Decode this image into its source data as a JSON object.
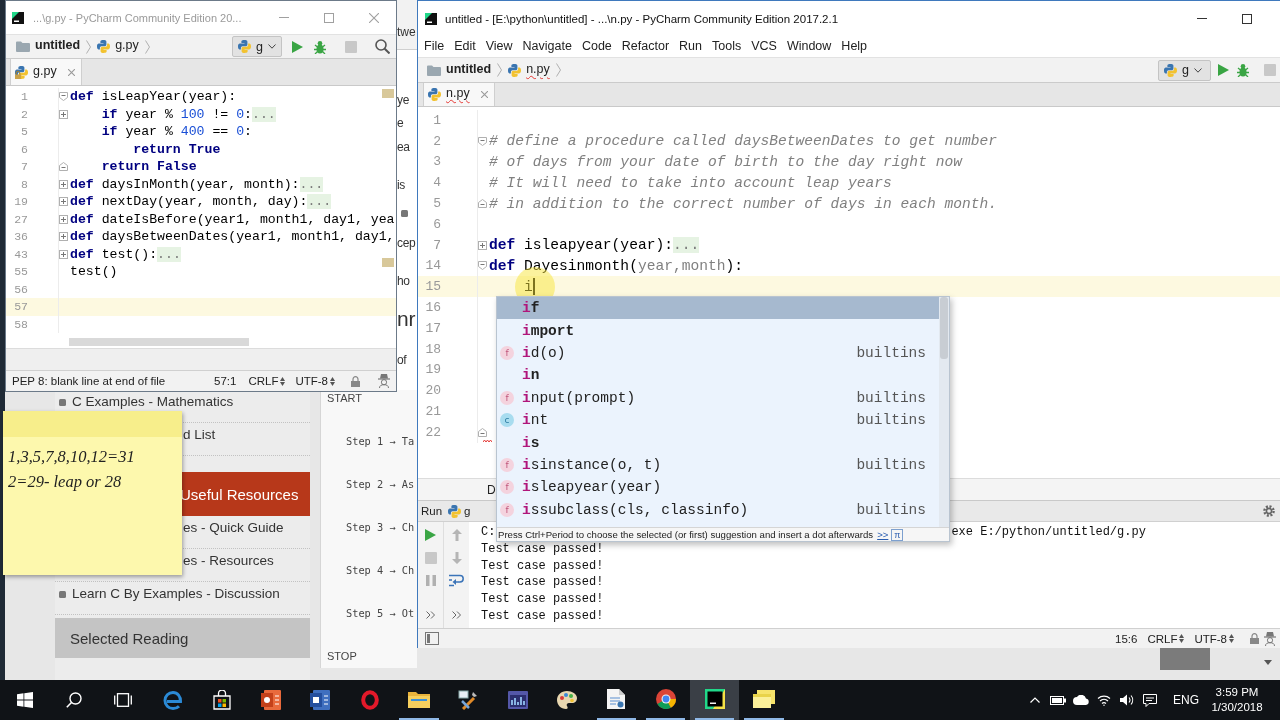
{
  "browser": {
    "strip": {
      "nav": "twe",
      "lines": [
        {
          "kind": "text",
          "text": "ye"
        },
        {
          "kind": "text",
          "text": "e"
        },
        {
          "kind": "text",
          "text": "ea"
        },
        {
          "kind": "text",
          "text": "is"
        },
        {
          "kind": "bullet"
        },
        {
          "kind": "text",
          "text": "cep"
        },
        {
          "kind": "text",
          "text": "ho"
        },
        {
          "kind": "heading",
          "text": "nr"
        },
        {
          "kind": "text",
          "text": "of"
        }
      ]
    },
    "sidebar": [
      {
        "kind": "link",
        "text": "C Examples - Mathematics",
        "covered": false
      },
      {
        "kind": "link",
        "text": "d List",
        "covered": true
      },
      {
        "kind": "header",
        "text": "Useful Resources",
        "covered": true,
        "color": "#b7381a"
      },
      {
        "kind": "link",
        "text": "es - Quick Guide",
        "covered": true
      },
      {
        "kind": "link",
        "text": "es - Resources",
        "covered": true
      },
      {
        "kind": "link",
        "text": "Learn C By Examples - Discussion",
        "covered": false
      },
      {
        "kind": "header",
        "text": "Selected Reading",
        "covered": false,
        "color": "#c4c4c4"
      }
    ],
    "flowchart": {
      "start": "START",
      "steps": [
        "Step 1 → Ta",
        "Step 2 → As",
        "Step 3 → Ch",
        "Step 4 → Ch",
        "Step 5 → Ot"
      ],
      "stop": "STOP"
    }
  },
  "left_window": {
    "title": "...\\g.py - PyCharm Community Edition 20...",
    "active": false,
    "controls": [
      {
        "kind": "minimize"
      },
      {
        "kind": "maximize"
      },
      {
        "kind": "close"
      }
    ],
    "breadcrumbs": [
      {
        "kind": "folder",
        "label": "untitled",
        "error": false
      },
      {
        "kind": "file",
        "label": "g.py",
        "error": false
      }
    ],
    "run_config": "g",
    "toolbar": [
      {
        "kind": "run",
        "disabled": false
      },
      {
        "kind": "debug",
        "disabled": false
      },
      {
        "kind": "stop",
        "disabled": true
      },
      {
        "kind": "search",
        "disabled": false
      }
    ],
    "tabs": [
      {
        "label": "g.py",
        "selected": true,
        "error": false,
        "read_only": true
      }
    ],
    "editor": {
      "lines": [
        {
          "number": "1",
          "marker": {
            "kind": "fold_open"
          },
          "current": false,
          "tokens": [
            {
              "kind": "keyword",
              "text": "def"
            },
            {
              "kind": "plain",
              "text": " isLeapYear(year):"
            }
          ]
        },
        {
          "number": "2",
          "marker": {
            "kind": "fold_collapsed"
          },
          "current": false,
          "tokens": [
            {
              "kind": "keyword",
              "text": "    if"
            },
            {
              "kind": "plain",
              "text": " year % "
            },
            {
              "kind": "number",
              "text": "100"
            },
            {
              "kind": "plain",
              "text": " != "
            },
            {
              "kind": "number",
              "text": "0"
            },
            {
              "kind": "plain",
              "text": ":"
            },
            {
              "kind": "folded",
              "text": "..."
            }
          ]
        },
        {
          "number": "5",
          "current": false,
          "tokens": [
            {
              "kind": "keyword",
              "text": "    if"
            },
            {
              "kind": "plain",
              "text": " year % "
            },
            {
              "kind": "number",
              "text": "400"
            },
            {
              "kind": "plain",
              "text": " == "
            },
            {
              "kind": "number",
              "text": "0"
            },
            {
              "kind": "plain",
              "text": ":"
            }
          ]
        },
        {
          "number": "6",
          "current": false,
          "tokens": [
            {
              "kind": "keyword",
              "text": "        return True"
            }
          ]
        },
        {
          "number": "7",
          "marker": {
            "kind": "fold_close"
          },
          "current": false,
          "tokens": [
            {
              "kind": "keyword",
              "text": "    return False"
            }
          ]
        },
        {
          "number": "8",
          "marker": {
            "kind": "fold_collapsed"
          },
          "current": false,
          "tokens": [
            {
              "kind": "keyword",
              "text": "def"
            },
            {
              "kind": "plain",
              "text": " daysInMonth(year, month):"
            },
            {
              "kind": "folded",
              "text": "..."
            }
          ]
        },
        {
          "number": "19",
          "marker": {
            "kind": "fold_collapsed"
          },
          "current": false,
          "tokens": [
            {
              "kind": "keyword",
              "text": "def"
            },
            {
              "kind": "plain",
              "text": " nextDay(year, month, day):"
            },
            {
              "kind": "folded",
              "text": "..."
            }
          ]
        },
        {
          "number": "27",
          "marker": {
            "kind": "fold_collapsed"
          },
          "current": false,
          "tokens": [
            {
              "kind": "keyword",
              "text": "def"
            },
            {
              "kind": "plain",
              "text": " dateIsBefore(year1, month1, day1, yea"
            }
          ]
        },
        {
          "number": "36",
          "marker": {
            "kind": "fold_collapsed"
          },
          "current": false,
          "tokens": [
            {
              "kind": "keyword",
              "text": "def"
            },
            {
              "kind": "plain",
              "text": " daysBetweenDates(year1, month1, day1,"
            }
          ]
        },
        {
          "number": "43",
          "marker": {
            "kind": "fold_collapsed"
          },
          "current": false,
          "tokens": [
            {
              "kind": "keyword",
              "text": "def"
            },
            {
              "kind": "plain",
              "text": " test():"
            },
            {
              "kind": "folded",
              "text": "..."
            }
          ]
        },
        {
          "number": "55",
          "current": false,
          "tokens": [
            {
              "kind": "plain",
              "text": "test()"
            }
          ]
        },
        {
          "number": "56",
          "current": false
        },
        {
          "number": "57",
          "current": true
        },
        {
          "number": "58",
          "current": false
        }
      ]
    },
    "status": {
      "message": "PEP 8: blank line at end of file",
      "position": "57:1",
      "line_separator": "CRLF",
      "encoding": "UTF-8"
    }
  },
  "sticky_note": {
    "lines": [
      "1,3,5,7,8,10,12=31",
      "2=29- leap or 28"
    ]
  },
  "right_window": {
    "title": "untitled - [E:\\python\\untitled] - ...\\n.py - PyCharm Community Edition 2017.2.1",
    "active": true,
    "controls": [
      {
        "kind": "minimize"
      },
      {
        "kind": "maximize"
      }
    ],
    "menu": [
      "File",
      "Edit",
      "View",
      "Navigate",
      "Code",
      "Refactor",
      "Run",
      "Tools",
      "VCS",
      "Window",
      "Help"
    ],
    "breadcrumbs": [
      {
        "kind": "folder",
        "label": "untitled",
        "error": false
      },
      {
        "kind": "file",
        "label": "n.py",
        "error": true
      }
    ],
    "run_config": "g",
    "toolbar": [
      {
        "kind": "run",
        "disabled": false
      },
      {
        "kind": "debug",
        "disabled": false
      },
      {
        "kind": "stop",
        "disabled": true
      }
    ],
    "tabs": [
      {
        "label": "n.py",
        "selected": true,
        "error": true,
        "read_only": false
      }
    ],
    "editor": {
      "lines": [
        {
          "number": "1",
          "current": false,
          "caret": false
        },
        {
          "number": "2",
          "marker": {
            "kind": "fold_open"
          },
          "current": false,
          "caret": false,
          "tokens": [
            {
              "kind": "comment",
              "text": "# define a procedure called daysBetweenDates to get number"
            }
          ]
        },
        {
          "number": "3",
          "current": false,
          "caret": false,
          "tokens": [
            {
              "kind": "comment",
              "text": "# of days from your date of birth to the day right now"
            }
          ]
        },
        {
          "number": "4",
          "current": false,
          "caret": false,
          "tokens": [
            {
              "kind": "comment",
              "text": "# It will need to take into account leap years"
            }
          ]
        },
        {
          "number": "5",
          "marker": {
            "kind": "fold_close"
          },
          "current": false,
          "caret": false,
          "tokens": [
            {
              "kind": "comment",
              "text": "# in addition to the correct number of days in each month."
            }
          ]
        },
        {
          "number": "6",
          "current": false,
          "caret": false
        },
        {
          "number": "7",
          "marker": {
            "kind": "fold_collapsed"
          },
          "current": false,
          "caret": false,
          "tokens": [
            {
              "kind": "keyword",
              "text": "def"
            },
            {
              "kind": "plain",
              "text": " isleapyear(year):"
            },
            {
              "kind": "folded",
              "text": "..."
            }
          ]
        },
        {
          "number": "14",
          "marker": {
            "kind": "fold_open"
          },
          "current": false,
          "caret": false,
          "tokens": [
            {
              "kind": "keyword",
              "text": "def"
            },
            {
              "kind": "plain",
              "text": " Dayesinmonth("
            },
            {
              "kind": "unused",
              "text": "year,month"
            },
            {
              "kind": "plain",
              "text": "):"
            }
          ]
        },
        {
          "number": "15",
          "current": true,
          "caret": true,
          "tokens": [
            {
              "kind": "plain",
              "text": "    i"
            }
          ]
        },
        {
          "number": "16",
          "current": false,
          "caret": false
        },
        {
          "number": "17",
          "current": false,
          "caret": false
        },
        {
          "number": "18",
          "current": false,
          "caret": false
        },
        {
          "number": "19",
          "current": false,
          "caret": false
        },
        {
          "number": "20",
          "current": false,
          "caret": false
        },
        {
          "number": "21",
          "current": false,
          "caret": false
        },
        {
          "number": "22",
          "marker": {
            "kind": "fold_close"
          },
          "current": false,
          "caret": false
        }
      ]
    },
    "completion": {
      "items": [
        {
          "kind": "keyword",
          "text": "if",
          "selected": true
        },
        {
          "kind": "keyword",
          "text": "import",
          "selected": false
        },
        {
          "kind": "function",
          "badge": "f",
          "text": "id(o)",
          "source": "builtins",
          "selected": false
        },
        {
          "kind": "keyword",
          "text": "in",
          "selected": false
        },
        {
          "kind": "function",
          "badge": "f",
          "text": "input(prompt)",
          "source": "builtins",
          "selected": false
        },
        {
          "kind": "class",
          "badge": "c",
          "text": "int",
          "source": "builtins",
          "selected": false
        },
        {
          "kind": "keyword",
          "text": "is",
          "selected": false
        },
        {
          "kind": "function",
          "badge": "f",
          "text": "isinstance(o, t)",
          "source": "builtins",
          "selected": false
        },
        {
          "kind": "function",
          "badge": "f",
          "text": "isleapyear(year)",
          "selected": false
        },
        {
          "kind": "function",
          "badge": "f",
          "text": "issubclass(cls, classinfo)",
          "source": "builtins",
          "selected": false
        }
      ],
      "hint": "Press Ctrl+Period to choose the selected (or first) suggestion and insert a dot afterwards",
      "hint_link": ">>",
      "pi": "π"
    },
    "structure_path": "D",
    "run_panel": {
      "title": "Run",
      "config": "g",
      "console": [
        {
          "segments": [
            "C:",
            "exe E:/python/untitled/g.py"
          ]
        },
        {
          "segments": [
            "Test case passed!"
          ]
        },
        {
          "segments": [
            "Test case passed!"
          ]
        },
        {
          "segments": [
            "Test case passed!"
          ]
        },
        {
          "segments": [
            "Test case passed!"
          ]
        },
        {
          "segments": [
            "Test case passed!"
          ]
        }
      ]
    },
    "status": {
      "position": "15:6",
      "line_separator": "CRLF",
      "encoding": "UTF-8"
    }
  },
  "taskbar": {
    "buttons": [
      {
        "kind": "start"
      },
      {
        "kind": "search"
      },
      {
        "kind": "task_view"
      }
    ],
    "apps": [
      {
        "kind": "e_browser",
        "running": false,
        "selected": false
      },
      {
        "kind": "store",
        "running": false,
        "selected": false
      },
      {
        "kind": "slides",
        "running": false,
        "selected": false
      },
      {
        "kind": "doc",
        "running": false,
        "selected": false
      },
      {
        "kind": "ring_browser",
        "running": false,
        "selected": false
      },
      {
        "kind": "folder",
        "running": true,
        "selected": false
      },
      {
        "kind": "tools",
        "running": false,
        "selected": false
      },
      {
        "kind": "dashboard",
        "running": false,
        "selected": false
      },
      {
        "kind": "palette",
        "running": false,
        "selected": false
      },
      {
        "kind": "notepad",
        "running": true,
        "selected": false
      },
      {
        "kind": "round_browser",
        "running": true,
        "selected": false
      },
      {
        "kind": "ide",
        "running": true,
        "selected": true
      },
      {
        "kind": "notes",
        "running": true,
        "selected": false
      }
    ],
    "tray": [
      {
        "kind": "chevron"
      },
      {
        "kind": "battery"
      },
      {
        "kind": "cloud"
      },
      {
        "kind": "wifi"
      },
      {
        "kind": "volume"
      },
      {
        "kind": "message"
      }
    ],
    "language": "ENG",
    "time": "3:59 PM",
    "date": "1/30/2018"
  }
}
